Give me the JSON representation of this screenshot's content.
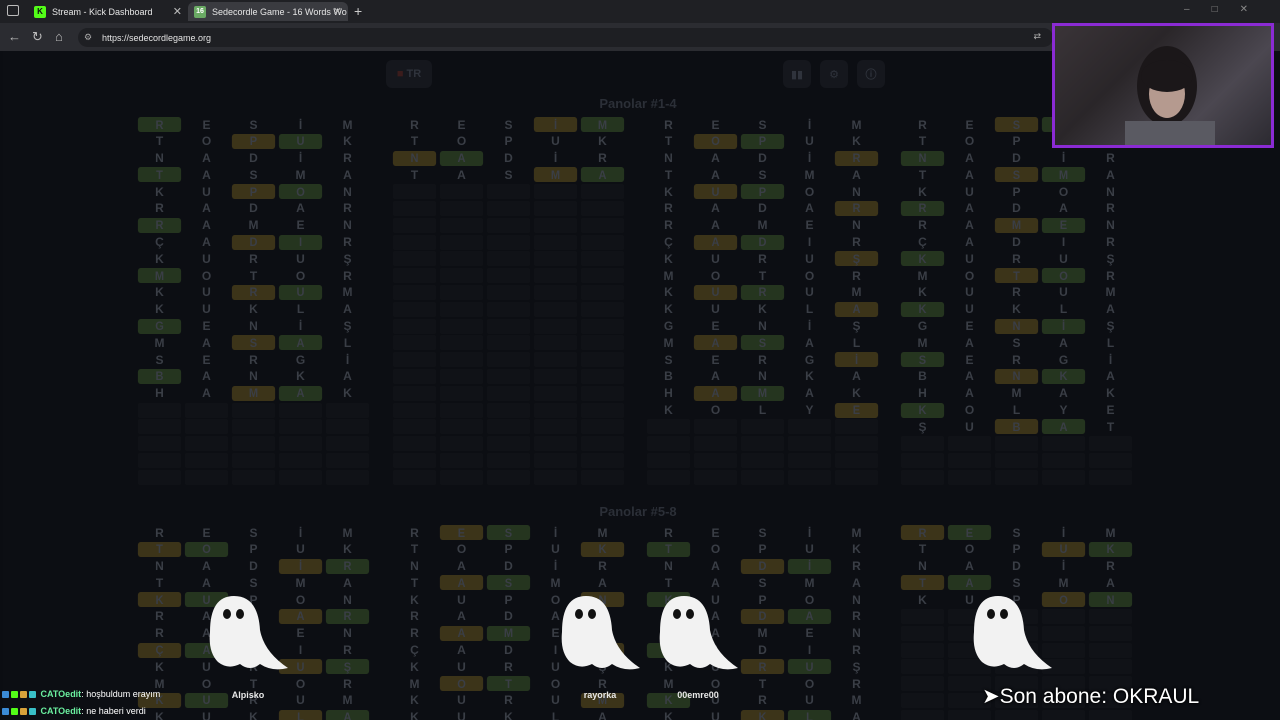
{
  "browser": {
    "tabs": [
      {
        "title": "Stream - Kick Dashboard",
        "favicon": "K"
      },
      {
        "title": "Sedecordle Game - 16 Words Wo",
        "favicon": "16"
      }
    ],
    "url": "https://sedecordlegame.org"
  },
  "page": {
    "language": "TR",
    "heading_1": "Panolar #1-4",
    "heading_2": "Panolar #5-8",
    "board_rows": [
      [
        "R",
        "E",
        "S",
        "İ",
        "M"
      ],
      [
        "T",
        "O",
        "P",
        "U",
        "K"
      ],
      [
        "N",
        "A",
        "D",
        "İ",
        "R"
      ],
      [
        "T",
        "A",
        "S",
        "M",
        "A"
      ],
      [
        "K",
        "U",
        "P",
        "O",
        "N"
      ],
      [
        "R",
        "A",
        "D",
        "A",
        "R"
      ],
      [
        "R",
        "A",
        "M",
        "E",
        "N"
      ],
      [
        "Ç",
        "A",
        "D",
        "I",
        "R"
      ],
      [
        "K",
        "U",
        "R",
        "U",
        "Ş"
      ],
      [
        "M",
        "O",
        "T",
        "O",
        "R"
      ],
      [
        "K",
        "U",
        "R",
        "U",
        "M"
      ],
      [
        "K",
        "U",
        "K",
        "L",
        "A"
      ],
      [
        "G",
        "E",
        "N",
        "İ",
        "Ş"
      ],
      [
        "M",
        "A",
        "S",
        "A",
        "L"
      ],
      [
        "S",
        "E",
        "R",
        "G",
        "İ"
      ],
      [
        "B",
        "A",
        "N",
        "K",
        "A"
      ],
      [
        "H",
        "A",
        "M",
        "A",
        "K"
      ],
      [
        "K",
        "O",
        "L",
        "Y",
        "E"
      ],
      [
        "Ş",
        "U",
        "B",
        "A",
        "T"
      ]
    ]
  },
  "overlay": {
    "viewers": [
      "Alpisko",
      "rayorka",
      "00emre00"
    ],
    "chat": [
      {
        "user": "CATOedit",
        "message": ": hoşbuldum erayım"
      },
      {
        "user": "CATOedit",
        "message": ": ne haberi verdi"
      }
    ],
    "last_subscriber": "➤Son abone: OKRAUL"
  },
  "colors": {
    "green": "#6aaa64",
    "yellow": "#c9b458",
    "accent": "#8b2bd4",
    "kick": "#53fc18"
  }
}
